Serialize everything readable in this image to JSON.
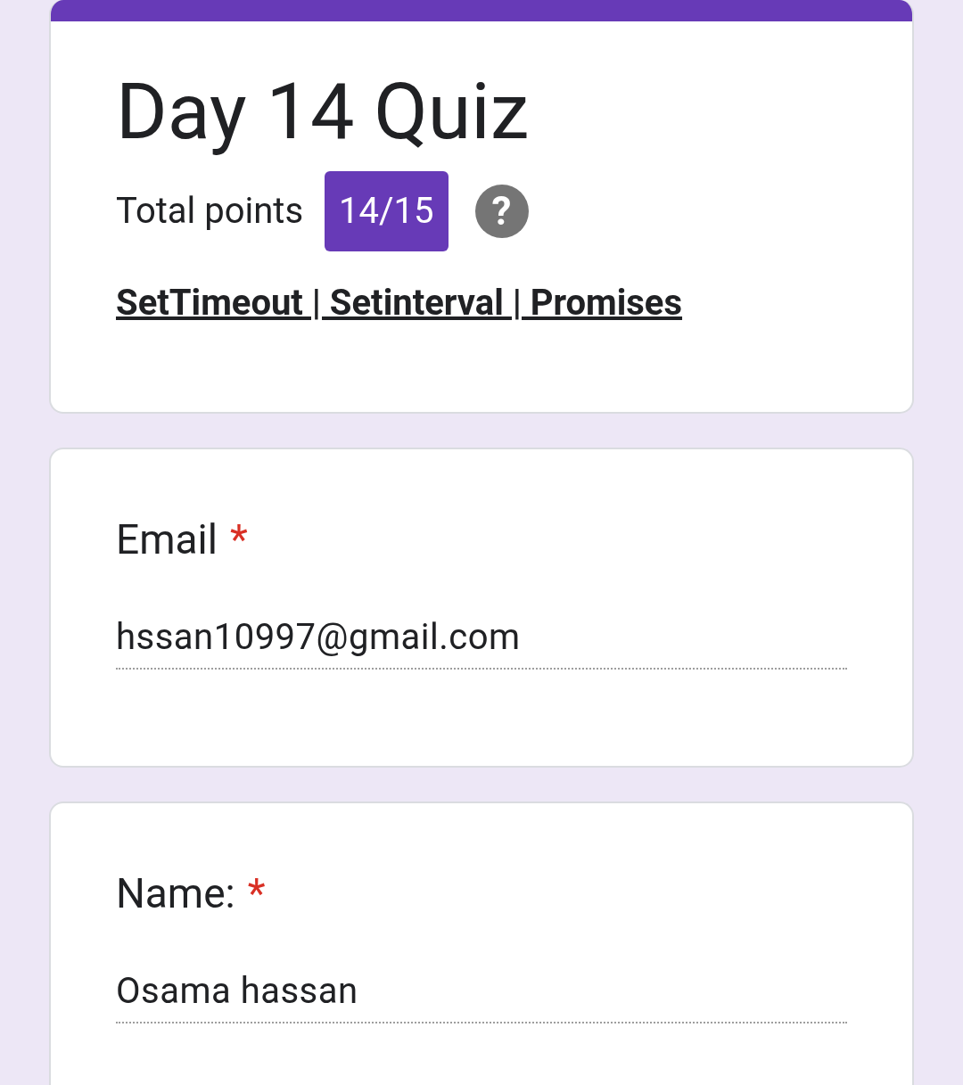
{
  "header": {
    "title": "Day 14 Quiz",
    "points_label": "Total points",
    "score": "14/15",
    "help": "?",
    "description": "SetTimeout | Setinterval | Promises"
  },
  "questions": [
    {
      "label": "Email",
      "required_mark": "*",
      "value": "hssan10997@gmail.com"
    },
    {
      "label": "Name:",
      "required_mark": "*",
      "value": "Osama hassan"
    }
  ]
}
